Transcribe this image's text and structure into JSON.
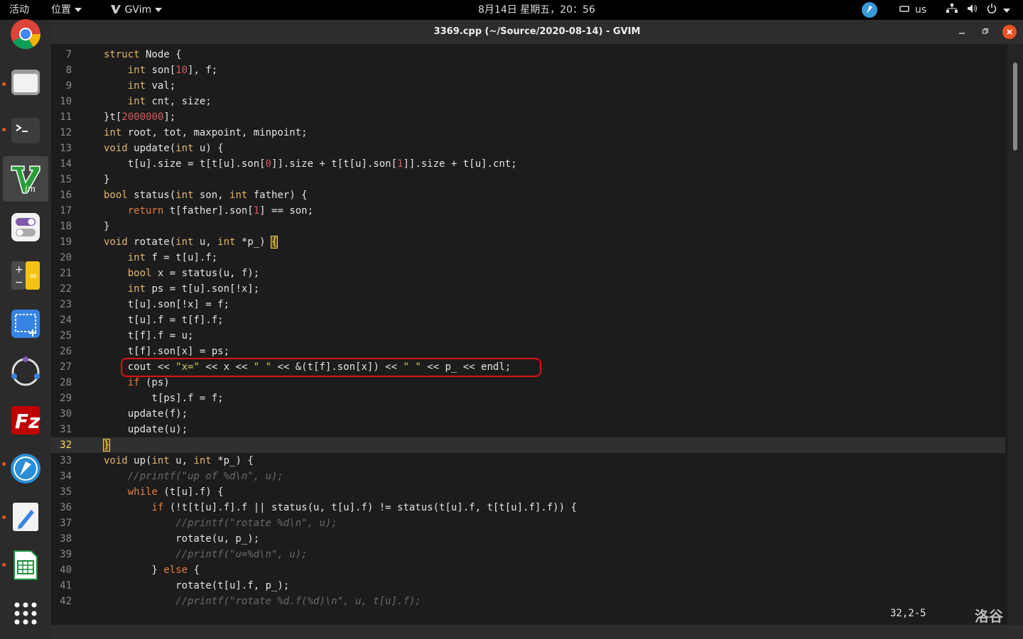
{
  "topbar": {
    "activities": "活动",
    "places": "位置",
    "app_name": "GVim",
    "clock": "8月14日 星期五，20：56",
    "keyboard_layout": "us"
  },
  "dock": {
    "apps": [
      "chrome-icon",
      "files-icon",
      "terminal-icon",
      "vim-icon",
      "tweaks-icon",
      "calculator-icon",
      "screenshot-icon",
      "circle-app-icon",
      "filezilla-icon",
      "pilot-app-icon",
      "text-editor-icon",
      "spreadsheet-icon",
      "app-grid-icon"
    ]
  },
  "window": {
    "title": "3369.cpp (~/Source/2020-08-14) - GVIM",
    "cursor_position": "32,2-5",
    "watermark": "洛谷"
  },
  "editor": {
    "lines": [
      {
        "n": "7",
        "code": "struct Node {"
      },
      {
        "n": "8",
        "code": "    int son[10], f;"
      },
      {
        "n": "9",
        "code": "    int val;"
      },
      {
        "n": "10",
        "code": "    int cnt, size;"
      },
      {
        "n": "11",
        "code": "}t[2000000];"
      },
      {
        "n": "12",
        "code": "int root, tot, maxpoint, minpoint;"
      },
      {
        "n": "13",
        "code": "void update(int u) {"
      },
      {
        "n": "14",
        "code": "    t[u].size = t[t[u].son[0]].size + t[t[u].son[1]].size + t[u].cnt;"
      },
      {
        "n": "15",
        "code": "}"
      },
      {
        "n": "16",
        "code": "bool status(int son, int father) {"
      },
      {
        "n": "17",
        "code": "    return t[father].son[1] == son;"
      },
      {
        "n": "18",
        "code": "}"
      },
      {
        "n": "19",
        "code": "void rotate(int u, int *p_) {"
      },
      {
        "n": "20",
        "code": "    int f = t[u].f;"
      },
      {
        "n": "21",
        "code": "    bool x = status(u, f);"
      },
      {
        "n": "22",
        "code": "    int ps = t[u].son[!x];"
      },
      {
        "n": "23",
        "code": "    t[u].son[!x] = f;"
      },
      {
        "n": "24",
        "code": "    t[u].f = t[f].f;"
      },
      {
        "n": "25",
        "code": "    t[f].f = u;"
      },
      {
        "n": "26",
        "code": "    t[f].son[x] = ps;"
      },
      {
        "n": "27",
        "code": "    cout << \"x=\" << x << \" \" << &(t[f].son[x]) << \" \" << p_ << endl;"
      },
      {
        "n": "28",
        "code": "    if (ps)"
      },
      {
        "n": "29",
        "code": "        t[ps].f = f;"
      },
      {
        "n": "30",
        "code": "    update(f);"
      },
      {
        "n": "31",
        "code": "    update(u);"
      },
      {
        "n": "32",
        "code": "}"
      },
      {
        "n": "33",
        "code": "void up(int u, int *p_) {"
      },
      {
        "n": "34",
        "code": "    //printf(\"up of %d\\n\", u);"
      },
      {
        "n": "35",
        "code": "    while (t[u].f) {"
      },
      {
        "n": "36",
        "code": "        if (!t[t[u].f].f || status(u, t[u].f) != status(t[u].f, t[t[u].f].f)) {"
      },
      {
        "n": "37",
        "code": "            //printf(\"rotate %d\\n\", u);"
      },
      {
        "n": "38",
        "code": "            rotate(u, p_);"
      },
      {
        "n": "39",
        "code": "            //printf(\"u=%d\\n\", u);"
      },
      {
        "n": "40",
        "code": "        } else {"
      },
      {
        "n": "41",
        "code": "            rotate(t[u].f, p_);"
      },
      {
        "n": "42",
        "code": "            //printf(\"rotate %d.f(%d)\\n\", u, t[u].f);"
      }
    ],
    "current_line": "32",
    "highlighted_line": "27"
  }
}
